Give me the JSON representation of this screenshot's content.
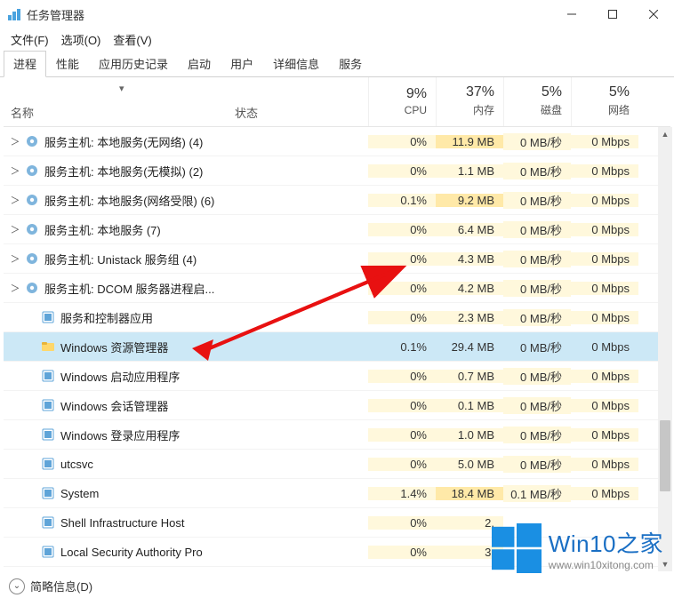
{
  "window": {
    "title": "任务管理器",
    "minimize": "最小化",
    "maximize": "最大化",
    "close": "关闭"
  },
  "menubar": {
    "file": "文件(F)",
    "options": "选项(O)",
    "view": "查看(V)"
  },
  "tabs": [
    {
      "label": "进程",
      "active": true
    },
    {
      "label": "性能",
      "active": false
    },
    {
      "label": "应用历史记录",
      "active": false
    },
    {
      "label": "启动",
      "active": false
    },
    {
      "label": "用户",
      "active": false
    },
    {
      "label": "详细信息",
      "active": false
    },
    {
      "label": "服务",
      "active": false
    }
  ],
  "columns": {
    "name": "名称",
    "status": "状态",
    "metrics": [
      {
        "pct": "9%",
        "label": "CPU"
      },
      {
        "pct": "37%",
        "label": "内存"
      },
      {
        "pct": "5%",
        "label": "磁盘"
      },
      {
        "pct": "5%",
        "label": "网络"
      }
    ]
  },
  "processes": [
    {
      "icon": "gear",
      "expand": true,
      "name": "服务主机: 本地服务(无网络) (4)",
      "cpu": "0%",
      "mem": "11.9 MB",
      "disk": "0 MB/秒",
      "net": "0 Mbps",
      "sel": false
    },
    {
      "icon": "gear",
      "expand": true,
      "name": "服务主机: 本地服务(无模拟) (2)",
      "cpu": "0%",
      "mem": "1.1 MB",
      "disk": "0 MB/秒",
      "net": "0 Mbps",
      "sel": false
    },
    {
      "icon": "gear",
      "expand": true,
      "name": "服务主机: 本地服务(网络受限) (6)",
      "cpu": "0.1%",
      "mem": "9.2 MB",
      "disk": "0 MB/秒",
      "net": "0 Mbps",
      "sel": false
    },
    {
      "icon": "gear",
      "expand": true,
      "name": "服务主机: 本地服务 (7)",
      "cpu": "0%",
      "mem": "6.4 MB",
      "disk": "0 MB/秒",
      "net": "0 Mbps",
      "sel": false
    },
    {
      "icon": "gear",
      "expand": true,
      "name": "服务主机: Unistack 服务组 (4)",
      "cpu": "0%",
      "mem": "4.3 MB",
      "disk": "0 MB/秒",
      "net": "0 Mbps",
      "sel": false
    },
    {
      "icon": "gear",
      "expand": true,
      "name": "服务主机: DCOM 服务器进程启...",
      "cpu": "0%",
      "mem": "4.2 MB",
      "disk": "0 MB/秒",
      "net": "0 Mbps",
      "sel": false
    },
    {
      "icon": "app",
      "expand": false,
      "name": "服务和控制器应用",
      "cpu": "0%",
      "mem": "2.3 MB",
      "disk": "0 MB/秒",
      "net": "0 Mbps",
      "sel": false
    },
    {
      "icon": "folder",
      "expand": false,
      "name": "Windows 资源管理器",
      "cpu": "0.1%",
      "mem": "29.4 MB",
      "disk": "0 MB/秒",
      "net": "0 Mbps",
      "sel": true
    },
    {
      "icon": "app",
      "expand": false,
      "name": "Windows 启动应用程序",
      "cpu": "0%",
      "mem": "0.7 MB",
      "disk": "0 MB/秒",
      "net": "0 Mbps",
      "sel": false
    },
    {
      "icon": "app",
      "expand": false,
      "name": "Windows 会话管理器",
      "cpu": "0%",
      "mem": "0.1 MB",
      "disk": "0 MB/秒",
      "net": "0 Mbps",
      "sel": false
    },
    {
      "icon": "app",
      "expand": false,
      "name": "Windows 登录应用程序",
      "cpu": "0%",
      "mem": "1.0 MB",
      "disk": "0 MB/秒",
      "net": "0 Mbps",
      "sel": false
    },
    {
      "icon": "app",
      "expand": false,
      "name": "utcsvc",
      "cpu": "0%",
      "mem": "5.0 MB",
      "disk": "0 MB/秒",
      "net": "0 Mbps",
      "sel": false
    },
    {
      "icon": "app",
      "expand": false,
      "name": "System",
      "cpu": "1.4%",
      "mem": "18.4 MB",
      "disk": "0.1 MB/秒",
      "net": "0 Mbps",
      "sel": false
    },
    {
      "icon": "app",
      "expand": false,
      "name": "Shell Infrastructure Host",
      "cpu": "0%",
      "mem": "2.",
      "disk": "",
      "net": "",
      "sel": false
    },
    {
      "icon": "app",
      "expand": false,
      "name": "Local Security Authority Pro",
      "cpu": "0%",
      "mem": "3.",
      "disk": "",
      "net": "",
      "sel": false
    }
  ],
  "footer": {
    "label": "简略信息(D)"
  },
  "watermark": {
    "brand": "Win10之家",
    "url": "www.win10xitong.com"
  }
}
